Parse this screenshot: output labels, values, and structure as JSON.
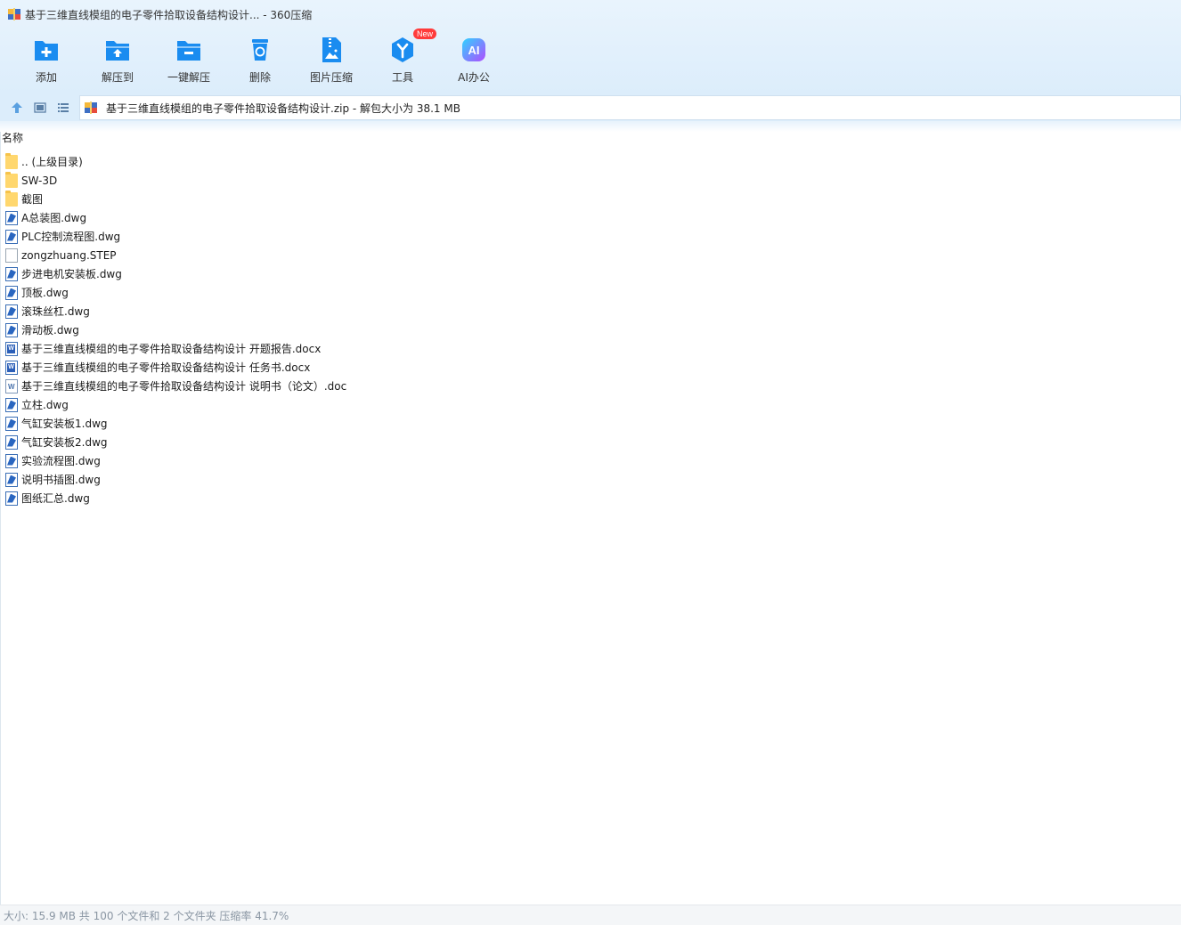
{
  "window": {
    "title": "基于三维直线模组的电子零件拾取设备结构设计... - 360压缩"
  },
  "toolbar": {
    "items": [
      {
        "label": "添加",
        "icon": "add-icon"
      },
      {
        "label": "解压到",
        "icon": "extract-to-icon"
      },
      {
        "label": "一键解压",
        "icon": "one-click-extract-icon"
      },
      {
        "label": "删除",
        "icon": "delete-icon"
      },
      {
        "label": "图片压缩",
        "icon": "image-compress-icon"
      },
      {
        "label": "工具",
        "icon": "tools-icon",
        "badge": "New"
      },
      {
        "label": "AI办公",
        "icon": "ai-office-icon",
        "icon_text": "AI"
      }
    ]
  },
  "navbar": {
    "address": "基于三维直线模组的电子零件拾取设备结构设计.zip - 解包大小为 38.1 MB"
  },
  "filelist": {
    "column_name": "名称",
    "rows": [
      {
        "name": ".. (上级目录)",
        "type": "folder"
      },
      {
        "name": "SW-3D",
        "type": "folder"
      },
      {
        "name": "截图",
        "type": "folder"
      },
      {
        "name": "A总装图.dwg",
        "type": "dwg"
      },
      {
        "name": "PLC控制流程图.dwg",
        "type": "dwg"
      },
      {
        "name": "zongzhuang.STEP",
        "type": "blank"
      },
      {
        "name": "步进电机安装板.dwg",
        "type": "dwg"
      },
      {
        "name": "顶板.dwg",
        "type": "dwg"
      },
      {
        "name": "滚珠丝杠.dwg",
        "type": "dwg"
      },
      {
        "name": "滑动板.dwg",
        "type": "dwg"
      },
      {
        "name": "基于三维直线模组的电子零件拾取设备结构设计 开题报告.docx",
        "type": "word"
      },
      {
        "name": "基于三维直线模组的电子零件拾取设备结构设计 任务书.docx",
        "type": "word"
      },
      {
        "name": "基于三维直线模组的电子零件拾取设备结构设计 说明书（论文）.doc",
        "type": "doc"
      },
      {
        "name": "立柱.dwg",
        "type": "dwg"
      },
      {
        "name": "气缸安装板1.dwg",
        "type": "dwg"
      },
      {
        "name": "气缸安装板2.dwg",
        "type": "dwg"
      },
      {
        "name": "实验流程图.dwg",
        "type": "dwg"
      },
      {
        "name": "说明书插图.dwg",
        "type": "dwg"
      },
      {
        "name": "图纸汇总.dwg",
        "type": "dwg"
      }
    ]
  },
  "status": {
    "text": "大小: 15.9 MB 共 100 个文件和 2 个文件夹 压缩率 41.7%"
  },
  "colors": {
    "accent": "#1a8cf0",
    "ai_gradient_start": "#2fd3ff",
    "ai_gradient_end": "#b04dff",
    "badge": "#ff3b3b"
  }
}
